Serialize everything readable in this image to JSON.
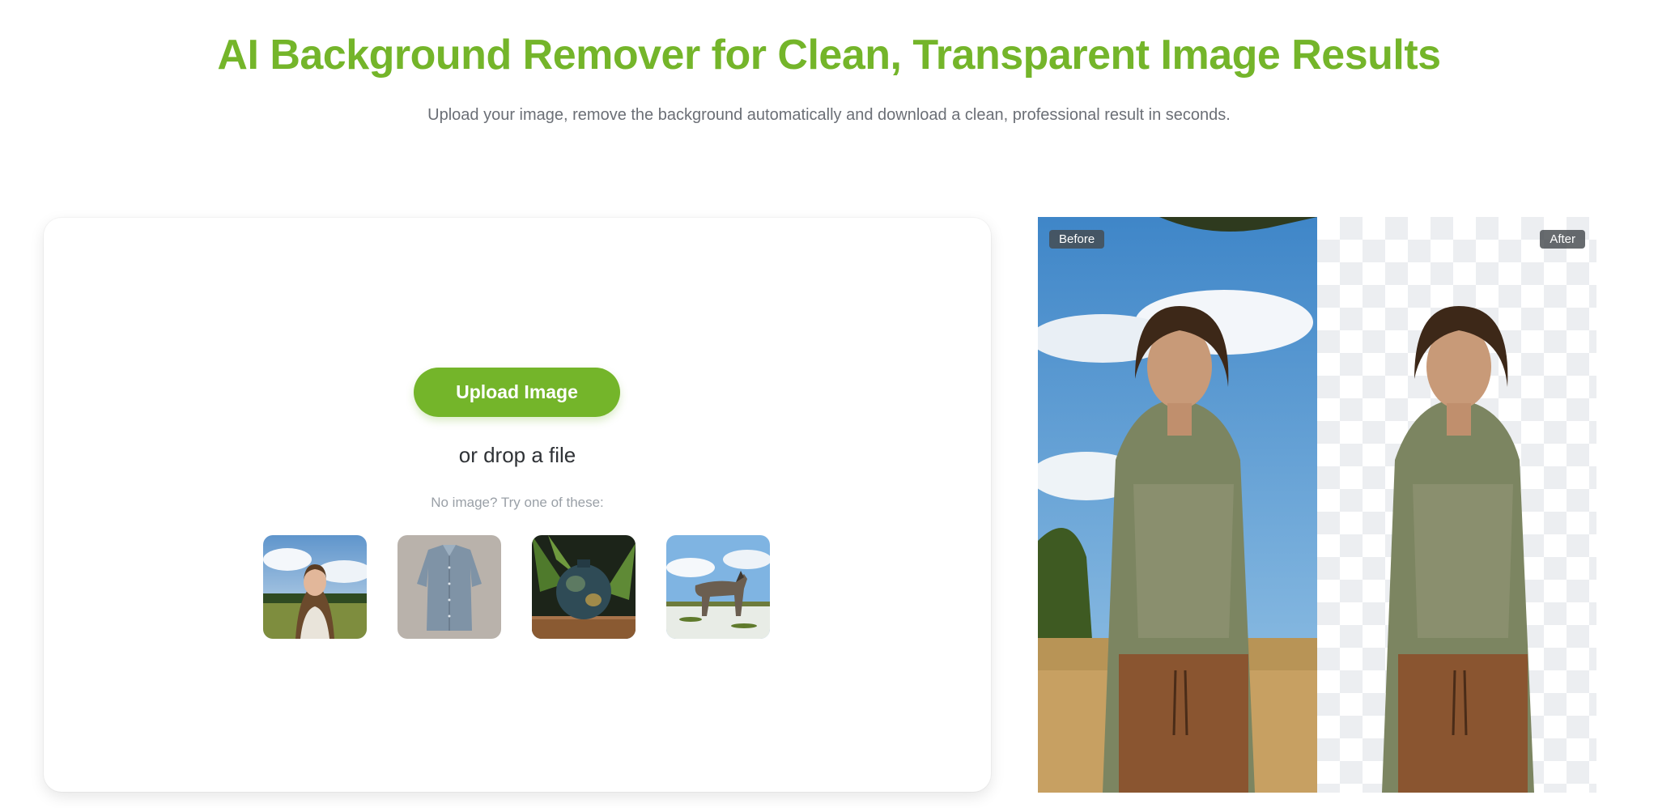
{
  "hero": {
    "title": "AI Background Remover for Clean, Transparent Image Results",
    "subtitle": "Upload your image, remove the background automatically and download a clean, professional result in seconds."
  },
  "upload": {
    "button_label": "Upload Image",
    "drop_text": "or drop a file",
    "try_text": "No image? Try one of these:"
  },
  "samples": [
    {
      "subject": "woman-in-field"
    },
    {
      "subject": "denim-shirt"
    },
    {
      "subject": "ceramic-vase"
    },
    {
      "subject": "wolf"
    }
  ],
  "compare": {
    "before_label": "Before",
    "after_label": "After"
  },
  "colors": {
    "accent": "#74b52a",
    "subtitle": "#6b6f76",
    "muted": "#9aa0a7"
  }
}
